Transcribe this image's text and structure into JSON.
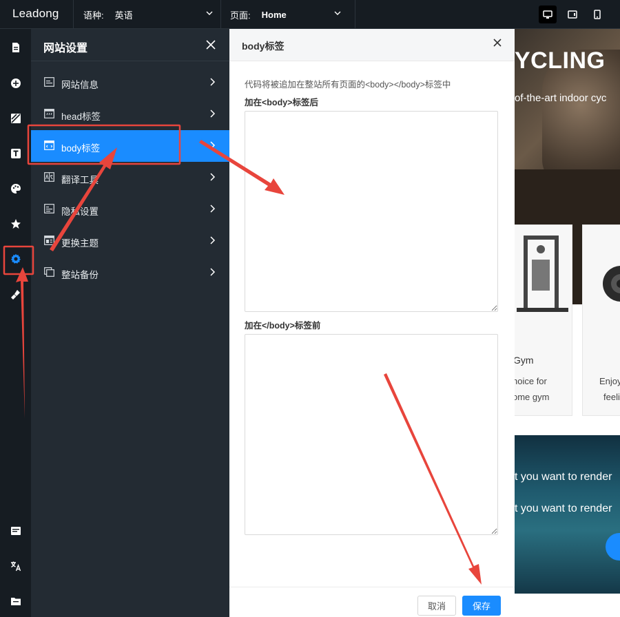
{
  "topbar": {
    "logo": "Leadong",
    "language_label": "语种:",
    "language_value": "英语",
    "page_label": "页面:",
    "page_value": "Home"
  },
  "panel": {
    "title": "网站设置",
    "items": [
      {
        "label": "网站信息",
        "icon": "website-info-icon"
      },
      {
        "label": "head标签",
        "icon": "head-tag-icon"
      },
      {
        "label": "body标签",
        "icon": "body-tag-icon",
        "active": true
      },
      {
        "label": "翻译工具",
        "icon": "translate-tool-icon"
      },
      {
        "label": "隐私设置",
        "icon": "privacy-icon"
      },
      {
        "label": "更换主题",
        "icon": "theme-icon"
      },
      {
        "label": "整站备份",
        "icon": "backup-icon"
      }
    ]
  },
  "dialog": {
    "title": "body标签",
    "description": "代码将被追加在整站所有页面的<body></body>标签中",
    "after_body_label": "加在<body>标签后",
    "after_body_value": "",
    "before_body_end_label": "加在</body>标签前",
    "before_body_end_value": "",
    "cancel_label": "取消",
    "save_label": "保存"
  },
  "preview": {
    "hero_title": "YCLING",
    "hero_subtitle": "of-the-art indoor cyc",
    "card1_title": "Gym",
    "card1_line1": "hoice for",
    "card1_line2": "ome gym",
    "card2_line1": "Enjoy",
    "card2_line2": "feeli",
    "sea_line1": "t you want to render",
    "sea_line2": "t you want to render"
  },
  "colors": {
    "accent": "#1a8cff",
    "annotation": "#e8453c",
    "panel_bg": "#232b33",
    "rail_bg": "#161c22"
  }
}
